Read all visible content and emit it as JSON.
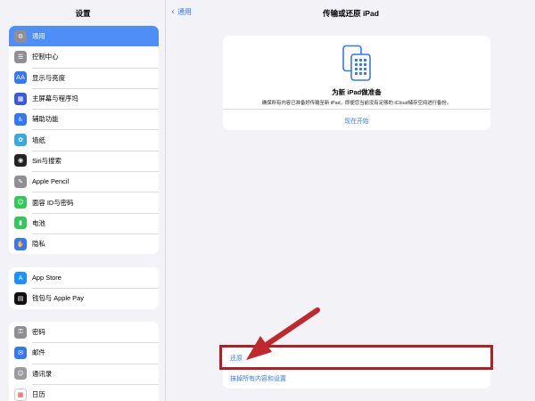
{
  "sidebar": {
    "title": "设置",
    "group1": [
      {
        "label": "通用",
        "icon": "gear-icon",
        "color": "#8e8e93",
        "glyph": "⚙",
        "selected": true
      },
      {
        "label": "控制中心",
        "icon": "control-center-icon",
        "color": "#8e8e93",
        "glyph": "☰"
      },
      {
        "label": "显示与亮度",
        "icon": "display-brightness-icon",
        "color": "#3478f6",
        "glyph": "AA"
      },
      {
        "label": "主屏幕与程序坞",
        "icon": "home-screen-icon",
        "color": "#3a5bd8",
        "glyph": "▦"
      },
      {
        "label": "辅助功能",
        "icon": "accessibility-icon",
        "color": "#3478f6",
        "glyph": "♿"
      },
      {
        "label": "墙纸",
        "icon": "wallpaper-icon",
        "color": "#36aadc",
        "glyph": "✿"
      },
      {
        "label": "Siri与搜索",
        "icon": "siri-icon",
        "color": "#222222",
        "glyph": "◉"
      },
      {
        "label": "Apple Pencil",
        "icon": "pencil-icon",
        "color": "#8e8e93",
        "glyph": "✎"
      },
      {
        "label": "面容 ID与密码",
        "icon": "face-id-icon",
        "color": "#34c759",
        "glyph": "☺"
      },
      {
        "label": "电池",
        "icon": "battery-icon",
        "color": "#34c759",
        "glyph": "▮"
      },
      {
        "label": "隐私",
        "icon": "privacy-hand-icon",
        "color": "#3478f6",
        "glyph": "✋"
      }
    ],
    "group2": [
      {
        "label": "App Store",
        "icon": "app-store-icon",
        "color": "#1e90ff",
        "glyph": "A"
      },
      {
        "label": "钱包与 Apple Pay",
        "icon": "wallet-icon",
        "color": "#111111",
        "glyph": "▤"
      }
    ],
    "group3": [
      {
        "label": "密码",
        "icon": "key-icon",
        "color": "#8e8e93",
        "glyph": "⚿"
      },
      {
        "label": "邮件",
        "icon": "mail-icon",
        "color": "#3478f6",
        "glyph": "✉"
      },
      {
        "label": "通讯录",
        "icon": "contacts-icon",
        "color": "#9a9a9f",
        "glyph": "☺"
      },
      {
        "label": "日历",
        "icon": "calendar-icon",
        "color": "#ffffff",
        "glyph": "▦"
      }
    ]
  },
  "main": {
    "back_label": "通用",
    "title": "传输或还原 iPad",
    "card": {
      "heading": "为新 iPad做准备",
      "description": "确保所有内容已准备好传输至新 iPad，即便您当前没有足够的 iCloud储存空间进行备份。",
      "link": "现在开始"
    },
    "actions": [
      "还原",
      "抹掉所有内容和设置"
    ]
  },
  "colors": {
    "accent": "#3478f6",
    "selected": "#4e8ff7",
    "annotation": "#c0282d"
  }
}
